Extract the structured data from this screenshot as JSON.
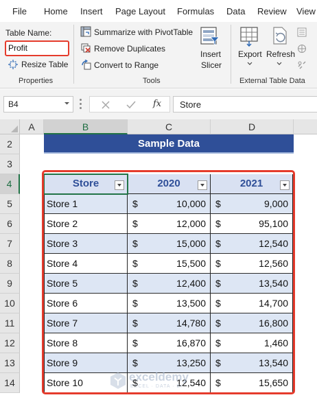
{
  "menu": {
    "file": "File",
    "home": "Home",
    "insert": "Insert",
    "page_layout": "Page Layout",
    "formulas": "Formulas",
    "data": "Data",
    "review": "Review",
    "view": "View"
  },
  "ribbon": {
    "properties": {
      "table_name_label": "Table Name:",
      "table_name_value": "Profit",
      "resize_table": "Resize Table",
      "group_label": "Properties"
    },
    "tools": {
      "summarize_pivot": "Summarize with PivotTable",
      "remove_duplicates": "Remove Duplicates",
      "convert_to_range": "Convert to Range",
      "insert_slicer_line1": "Insert",
      "insert_slicer_line2": "Slicer",
      "group_label": "Tools"
    },
    "external": {
      "export": "Export",
      "refresh": "Refresh",
      "group_label": "External Table Data"
    }
  },
  "formula_bar": {
    "name_box": "B4",
    "fx_symbol": "fx",
    "content": "Store"
  },
  "columns": [
    "A",
    "B",
    "C",
    "D"
  ],
  "rows": [
    "2",
    "3",
    "4",
    "5",
    "6",
    "7",
    "8",
    "9",
    "10",
    "11",
    "12",
    "13",
    "14"
  ],
  "sheet": {
    "title": "Sample Data",
    "table": {
      "headers": [
        "Store",
        "2020",
        "2021"
      ],
      "rows": [
        {
          "store": "Store 1",
          "y2020": "10,000",
          "y2021": "9,000"
        },
        {
          "store": "Store 2",
          "y2020": "12,000",
          "y2021": "95,100"
        },
        {
          "store": "Store 3",
          "y2020": "15,000",
          "y2021": "12,540"
        },
        {
          "store": "Store 4",
          "y2020": "15,500",
          "y2021": "12,560"
        },
        {
          "store": "Store 5",
          "y2020": "12,400",
          "y2021": "13,540"
        },
        {
          "store": "Store 6",
          "y2020": "13,500",
          "y2021": "14,700"
        },
        {
          "store": "Store 7",
          "y2020": "14,780",
          "y2021": "16,800"
        },
        {
          "store": "Store 8",
          "y2020": "16,870",
          "y2021": "1,460"
        },
        {
          "store": "Store 9",
          "y2020": "13,250",
          "y2021": "13,540"
        },
        {
          "store": "Store 10",
          "y2020": "12,540",
          "y2021": "15,650"
        }
      ],
      "currency": "$"
    }
  },
  "watermark": {
    "name": "exceldemy",
    "tagline": "EXCEL · DATA · BI"
  },
  "colors": {
    "excel_green": "#217346",
    "title_fill": "#2f4f98",
    "band_fill": "#dde6f4",
    "header_fill": "#d9e1f2",
    "highlight_red": "#e53b2c"
  }
}
